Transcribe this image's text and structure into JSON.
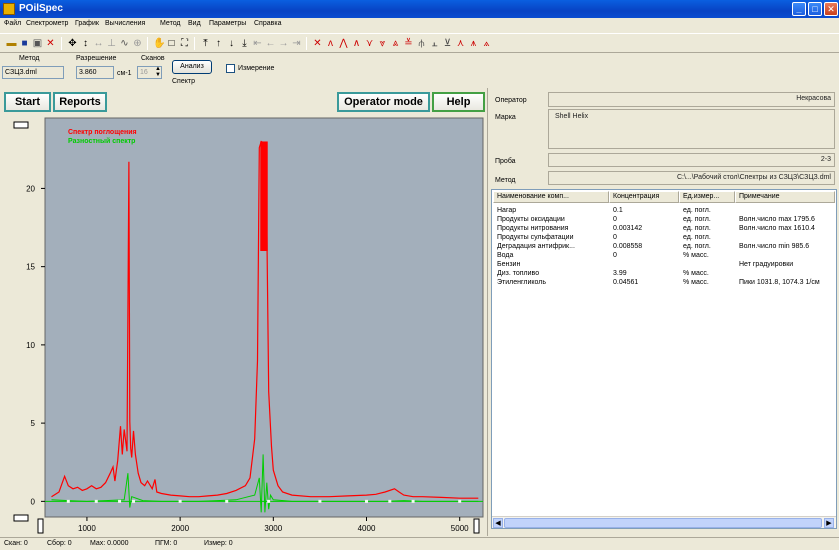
{
  "window": {
    "title": "POilSpec",
    "minimize": "_",
    "maximize": "□",
    "close": "✕"
  },
  "menu": [
    "Файл",
    "Спектрометр",
    "График",
    "Вычисления",
    "Метод",
    "Вид",
    "Параметры",
    "Справка"
  ],
  "settings": {
    "method_label": "Метод",
    "method_value": "СЗЦЗ.dml",
    "resolution_label": "Разрешение",
    "resolution_value": "3.860",
    "resolution_unit": "см-1",
    "scans_label": "Сканов",
    "scans_value": "16",
    "analysis_button": "Анализ",
    "measure_checkbox_label": "Измерение",
    "spectrum_label": "Спектр"
  },
  "buttons": {
    "start": "Start",
    "reports": "Reports",
    "operator_mode": "Operator mode",
    "help": "Help"
  },
  "chart_data": {
    "type": "line",
    "legend": [
      "Спектр поглощения",
      "Разностный спектр"
    ],
    "legend_colors": [
      "#ff0000",
      "#00cc00"
    ],
    "xlim": [
      550,
      5250
    ],
    "ylim": [
      -1,
      24.5
    ],
    "xticks": [
      1000,
      2000,
      3000,
      4000,
      5000
    ],
    "yticks": [
      0,
      5,
      10,
      15,
      20
    ],
    "background": "#a3afbb",
    "series": [
      {
        "color": "#ff0000",
        "x": [
          620,
          700,
          760,
          800,
          850,
          900,
          950,
          1000,
          1050,
          1100,
          1150,
          1200,
          1250,
          1280,
          1300,
          1330,
          1360,
          1380,
          1400,
          1430,
          1450,
          1460,
          1470,
          1480,
          1500,
          1520,
          1550,
          1580,
          1620,
          1650,
          1700,
          1730,
          1750,
          1800,
          1900,
          2000,
          2100,
          2200,
          2300,
          2400,
          2500,
          2600,
          2700,
          2750,
          2800,
          2830,
          2850,
          2870,
          2900,
          2920,
          2950,
          2980,
          3000,
          3050,
          3100,
          3200,
          3400,
          3600,
          3800,
          4000,
          4100,
          4200,
          4300,
          4350,
          4400,
          4500,
          4600,
          4800,
          5000,
          5200
        ],
        "y": [
          0.3,
          0.6,
          1.6,
          1.0,
          0.8,
          0.9,
          0.7,
          0.8,
          1.0,
          0.8,
          0.9,
          1.2,
          1.8,
          2.2,
          1.3,
          2.6,
          4.8,
          3.0,
          4.6,
          3.2,
          21.7,
          5.1,
          3.4,
          2.8,
          4.5,
          3.0,
          1.8,
          1.2,
          1.0,
          1.3,
          0.8,
          1.4,
          0.6,
          0.5,
          0.4,
          0.35,
          0.3,
          0.3,
          0.35,
          0.4,
          0.5,
          0.7,
          1.0,
          1.5,
          4.0,
          9.0,
          22.6,
          23.0,
          22.9,
          22.7,
          7.0,
          3.5,
          2.0,
          1.0,
          0.6,
          0.4,
          0.3,
          0.3,
          0.35,
          0.4,
          0.45,
          0.6,
          0.8,
          0.6,
          0.4,
          0.3,
          0.3,
          0.25,
          0.2,
          0.2
        ]
      },
      {
        "color": "#00cc00",
        "x": [
          620,
          800,
          1000,
          1200,
          1400,
          1440,
          1460,
          1480,
          1600,
          1800,
          2000,
          2200,
          2400,
          2600,
          2800,
          2850,
          2870,
          2890,
          2910,
          2930,
          2950,
          2970,
          3000,
          3200,
          3400,
          3600,
          3800,
          4000,
          4200,
          4400,
          4600,
          4800,
          5000,
          5200
        ],
        "y": [
          0.1,
          0.05,
          0.0,
          0.05,
          0.1,
          1.8,
          -0.4,
          0.3,
          0.05,
          0.0,
          0.0,
          0.0,
          0.05,
          0.1,
          0.4,
          1.5,
          -0.7,
          3.0,
          -0.7,
          1.2,
          -0.5,
          0.4,
          0.1,
          0.0,
          0.0,
          0.0,
          0.0,
          0.0,
          0.0,
          0.05,
          0.0,
          0.0,
          0.0,
          0.0
        ]
      }
    ],
    "markers": [
      800,
      1100,
      1350,
      1500,
      2000,
      2500,
      2950,
      3500,
      4000,
      4250,
      4500,
      5000
    ]
  },
  "right_panel": {
    "operator_label": "Оператор",
    "operator_value": "Некрасова",
    "brand_label": "Марка",
    "brand_value": "Shell Helix",
    "sample_label": "Проба",
    "sample_value": "2-3",
    "method_label": "Метод",
    "method_value": "C:\\...\\Рабочий стол\\Спектры из СЗЦЗ\\СЗЦЗ.dml"
  },
  "results": {
    "headers": [
      "Наименование комп...",
      "Концентрация",
      "Ед.измер...",
      "Примечание"
    ],
    "rows": [
      [
        "Нагар",
        "0.1",
        "ед. погл.",
        ""
      ],
      [
        "Продукты оксидации",
        "0",
        "ед. погл.",
        "Волн.число max 1795.6"
      ],
      [
        "Продукты нитрования",
        "0.003142",
        "ед. погл.",
        "Волн.число max 1610.4"
      ],
      [
        "Продукты сульфатации",
        "0",
        "ед. погл.",
        ""
      ],
      [
        "Деградация антифрик...",
        "0.008558",
        "ед. погл.",
        "Волн.число min 985.6"
      ],
      [
        "Вода",
        "0",
        "% масс.",
        ""
      ],
      [
        "Бензин",
        "",
        "",
        "Нет градуировки"
      ],
      [
        "Диз. топливо",
        "3.99",
        "% масс.",
        ""
      ],
      [
        "Этиленгликоль",
        "0.04561",
        "% масс.",
        "Пики 1031.8, 1074.3 1/см"
      ]
    ]
  },
  "status": [
    "Скан: 0",
    "Сбор: 0",
    "Max: 0.0000",
    "ПГМ: 0",
    "Измер: 0"
  ]
}
